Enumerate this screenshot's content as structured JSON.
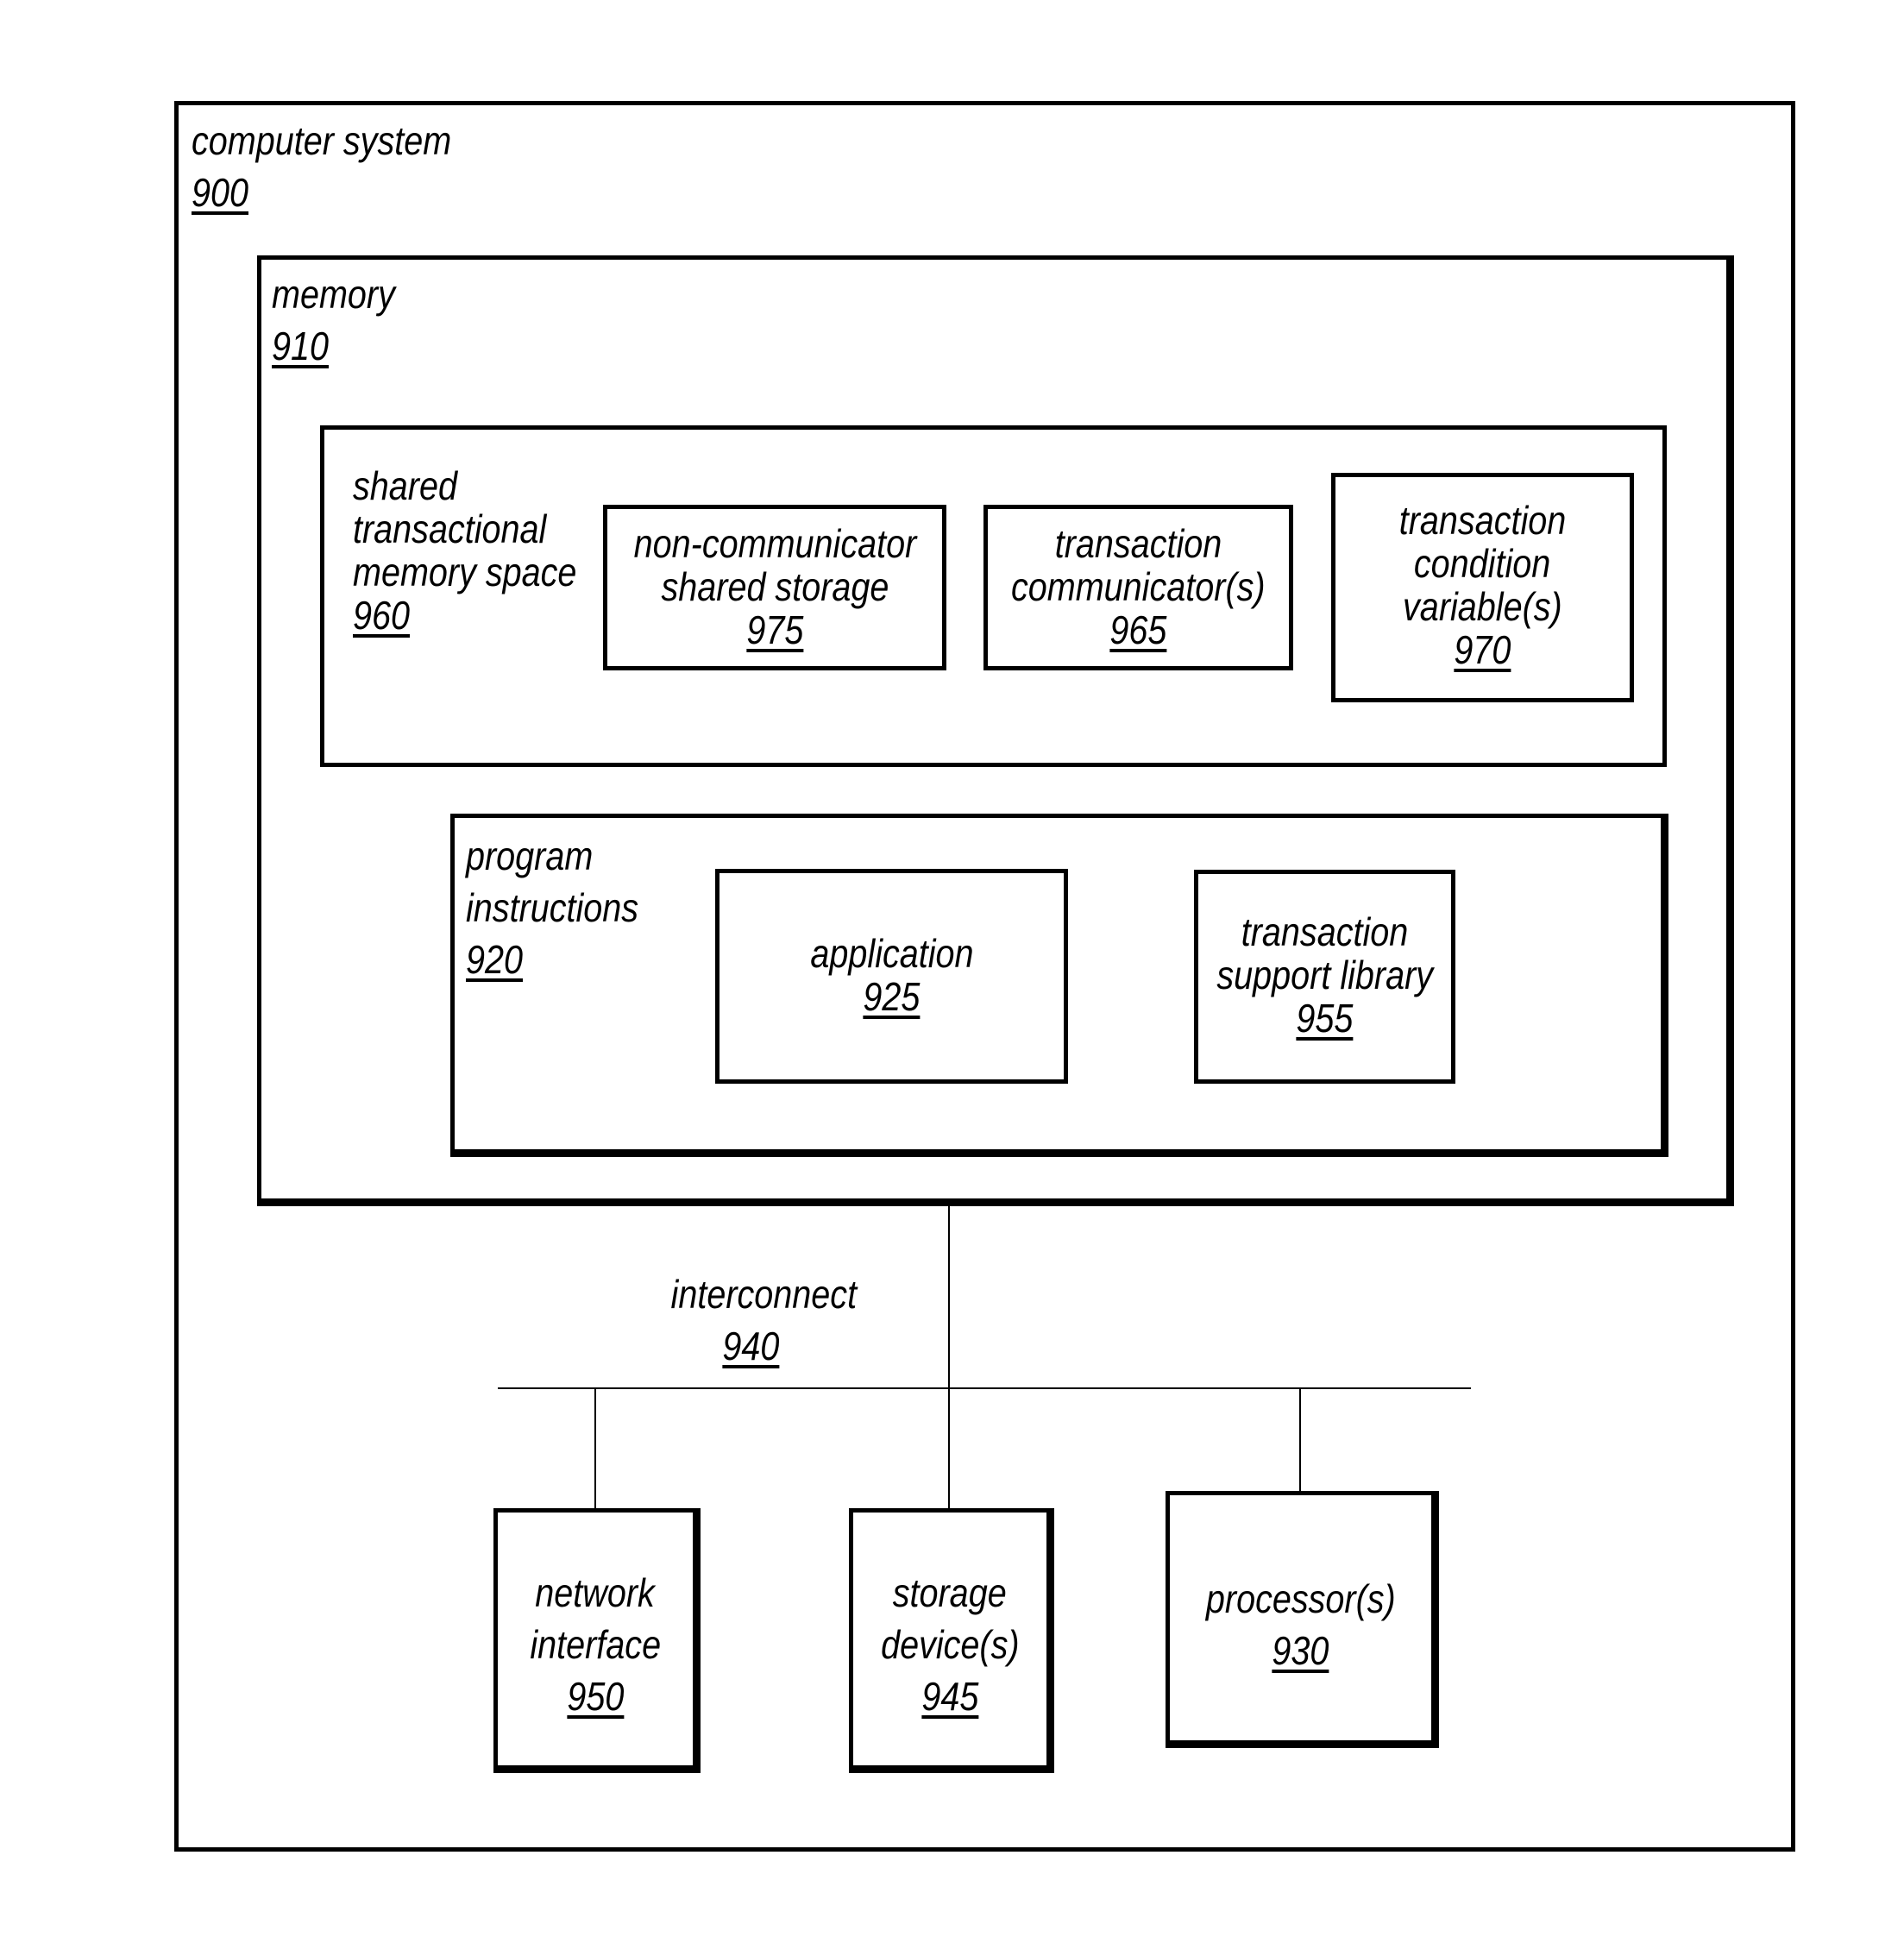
{
  "computer_system": {
    "label": "computer system",
    "ref": "900"
  },
  "memory": {
    "label": "memory",
    "ref": "910"
  },
  "shared_space": {
    "lines": [
      "shared",
      "transactional",
      "memory space"
    ],
    "ref": "960"
  },
  "non_communicator_storage": {
    "lines": [
      "non-communicator",
      "shared storage"
    ],
    "ref": "975"
  },
  "transaction_communicators": {
    "lines": [
      "transaction",
      "communicator(s)"
    ],
    "ref": "965"
  },
  "transaction_condition_variables": {
    "lines": [
      "transaction",
      "condition",
      "variable(s)"
    ],
    "ref": "970"
  },
  "program_instructions": {
    "lines": [
      "program",
      "instructions"
    ],
    "ref": "920"
  },
  "application": {
    "lines": [
      "application"
    ],
    "ref": "925"
  },
  "transaction_support_library": {
    "lines": [
      "transaction",
      "support library"
    ],
    "ref": "955"
  },
  "interconnect": {
    "label": "interconnect",
    "ref": "940"
  },
  "network_interface": {
    "lines": [
      "network",
      "interface"
    ],
    "ref": "950"
  },
  "storage_devices": {
    "lines": [
      "storage",
      "device(s)"
    ],
    "ref": "945"
  },
  "processors": {
    "lines": [
      "processor(s)"
    ],
    "ref": "930"
  }
}
